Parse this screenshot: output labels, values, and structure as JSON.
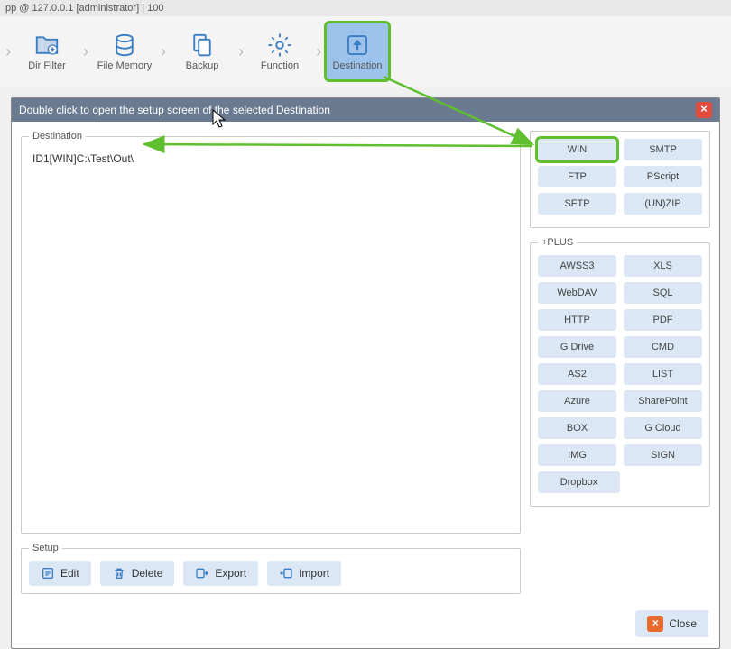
{
  "titlebar": "pp @ 127.0.0.1 [administrator]    |    100",
  "toolbar": {
    "items": [
      {
        "name": "dir-filter",
        "label": "Dir Filter"
      },
      {
        "name": "file-memory",
        "label": "File Memory"
      },
      {
        "name": "backup",
        "label": "Backup"
      },
      {
        "name": "function",
        "label": "Function"
      },
      {
        "name": "destination",
        "label": "Destination",
        "active": true,
        "highlight": true
      }
    ]
  },
  "dialog": {
    "title": "Double click to open the setup screen of the selected Destination",
    "dest_legend": "Destination",
    "dest_entries": [
      "ID1[WIN]C:\\Test\\Out\\"
    ],
    "setup_legend": "Setup",
    "setup": {
      "edit": "Edit",
      "delete": "Delete",
      "export": "Export",
      "import": "Import"
    },
    "types_basic": [
      [
        "WIN",
        "SMTP"
      ],
      [
        "FTP",
        "PScript"
      ],
      [
        "SFTP",
        "(UN)ZIP"
      ]
    ],
    "plus_legend": "+PLUS",
    "types_plus": [
      [
        "AWSS3",
        "XLS"
      ],
      [
        "WebDAV",
        "SQL"
      ],
      [
        "HTTP",
        "PDF"
      ],
      [
        "G Drive",
        "CMD"
      ],
      [
        "AS2",
        "LIST"
      ],
      [
        "Azure",
        "SharePoint"
      ],
      [
        "BOX",
        "G Cloud"
      ],
      [
        "IMG",
        "SIGN"
      ],
      [
        "Dropbox",
        ""
      ]
    ],
    "close": "Close"
  }
}
